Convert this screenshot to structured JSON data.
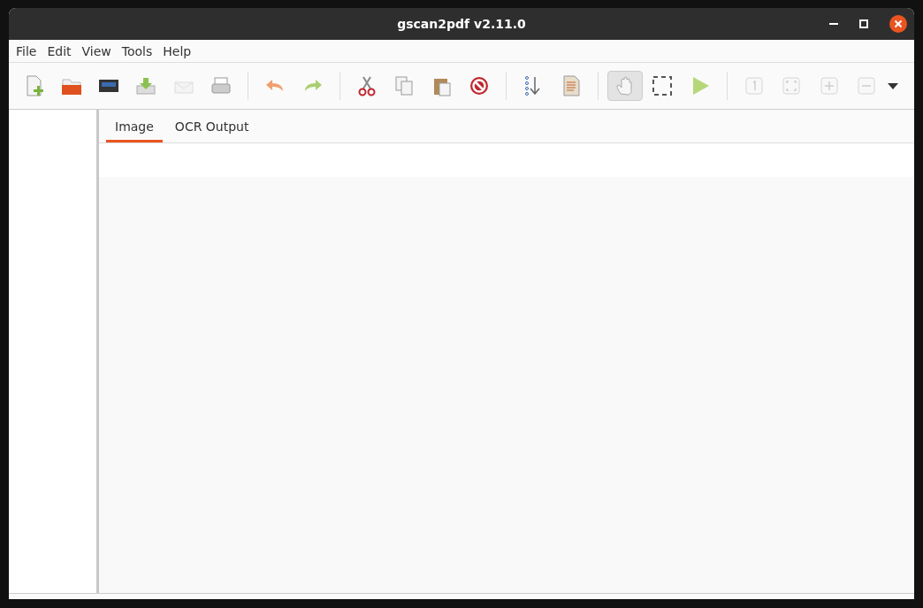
{
  "window": {
    "title": "gscan2pdf v2.11.0"
  },
  "menu": [
    "File",
    "Edit",
    "View",
    "Tools",
    "Help"
  ],
  "toolbar": [
    [
      {
        "disabled": false
      },
      {
        "disabled": false
      },
      {
        "disabled": false
      },
      {
        "disabled": false
      },
      {
        "disabled": true
      },
      {
        "disabled": false
      }
    ],
    [
      {
        "disabled": false
      },
      {
        "disabled": false
      }
    ],
    [
      {
        "disabled": false
      },
      {
        "disabled": false
      },
      {
        "disabled": false
      },
      {
        "disabled": false
      }
    ],
    [
      {
        "disabled": false
      },
      {
        "disabled": false
      }
    ],
    [
      {
        "disabled": false,
        "selected": true
      },
      {
        "disabled": false,
        "selected": false
      },
      {
        "disabled": false,
        "selected": false
      }
    ],
    [
      {
        "disabled": true
      },
      {
        "disabled": true
      },
      {
        "disabled": true
      },
      {
        "disabled": true
      }
    ]
  ],
  "tabs": [
    {
      "label": "Image",
      "selected": true
    },
    {
      "label": "OCR Output",
      "selected": false
    }
  ]
}
